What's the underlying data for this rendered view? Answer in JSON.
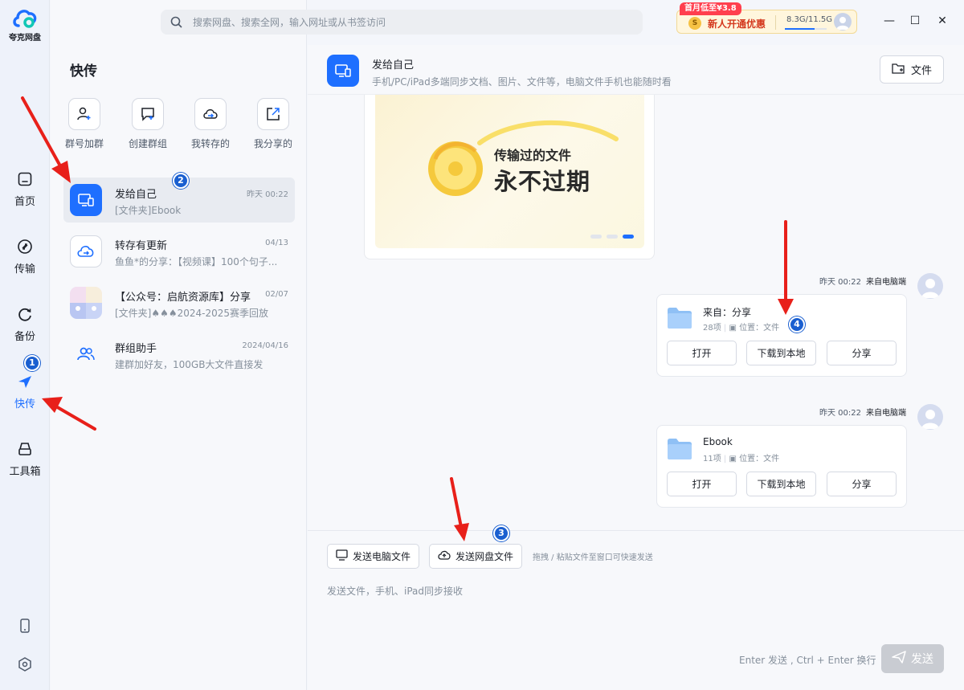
{
  "app": {
    "logo_text": "夸克网盘"
  },
  "rail": {
    "items": [
      {
        "label": "首页",
        "icon": "home-icon"
      },
      {
        "label": "传输",
        "icon": "transfer-icon"
      },
      {
        "label": "备份",
        "icon": "backup-icon"
      },
      {
        "label": "快传",
        "icon": "quick-send-icon",
        "active": true
      },
      {
        "label": "工具箱",
        "icon": "toolbox-icon"
      }
    ],
    "bottom": [
      "phone-icon",
      "settings-icon"
    ]
  },
  "search": {
    "placeholder": "搜索网盘、搜索全网，输入网址或从书签访问"
  },
  "promo": {
    "tag": "首月低至¥3.8",
    "coin": "S",
    "text": "新人开通优惠",
    "quota": "8.3G/11.5G",
    "usage_fraction": 0.72
  },
  "window": {
    "minimize": "—",
    "maximize": "☐",
    "close": "✕"
  },
  "panel": {
    "title": "快传",
    "quick_actions": [
      "群号加群",
      "创建群组",
      "我转存的",
      "我分享的"
    ],
    "conversations": [
      {
        "name": "发给自己",
        "preview": "[文件夹]Ebook",
        "time": "昨天 00:22"
      },
      {
        "name": "转存有更新",
        "preview": "鱼鱼*的分享：【视频课】100个句子...",
        "time": "04/13"
      },
      {
        "name": "【公众号：启航资源库】分享",
        "preview": "[文件夹]♠♠♠2024-2025赛季回放",
        "time": "02/07"
      },
      {
        "name": "群组助手",
        "preview": "建群加好友，100GB大文件直接发",
        "time": "2024/04/16"
      }
    ]
  },
  "chat": {
    "title": "发给自己",
    "subtitle": "手机/PC/iPad多端同步文档、图片、文件等，电脑文件手机也能随时看",
    "file_button": "文件",
    "banner": {
      "line1": "传输过的文件",
      "line2": "永不过期"
    },
    "messages": [
      {
        "time": "昨天 00:22",
        "source": "来自电脑端",
        "folder": "来自：分享",
        "count": "28项",
        "location": "位置：文件",
        "actions": [
          "打开",
          "下载到本地",
          "分享"
        ]
      },
      {
        "time": "昨天 00:22",
        "source": "来自电脑端",
        "folder": "Ebook",
        "count": "11项",
        "location": "位置：文件",
        "actions": [
          "打开",
          "下载到本地",
          "分享"
        ]
      }
    ]
  },
  "composer": {
    "send_pc": "发送电脑文件",
    "send_cloud": "发送网盘文件",
    "hint": "拖拽 / 粘贴文件至窗口可快速发送",
    "placeholder": "发送文件，手机、iPad同步接收",
    "enter_hint": "Enter 发送 , Ctrl + Enter 换行",
    "send": "发送"
  },
  "annotations": [
    "1",
    "2",
    "3",
    "4"
  ],
  "colors": {
    "accent": "#1e6fff",
    "promo_red": "#ff3f4e",
    "arrow": "#e8201a"
  }
}
